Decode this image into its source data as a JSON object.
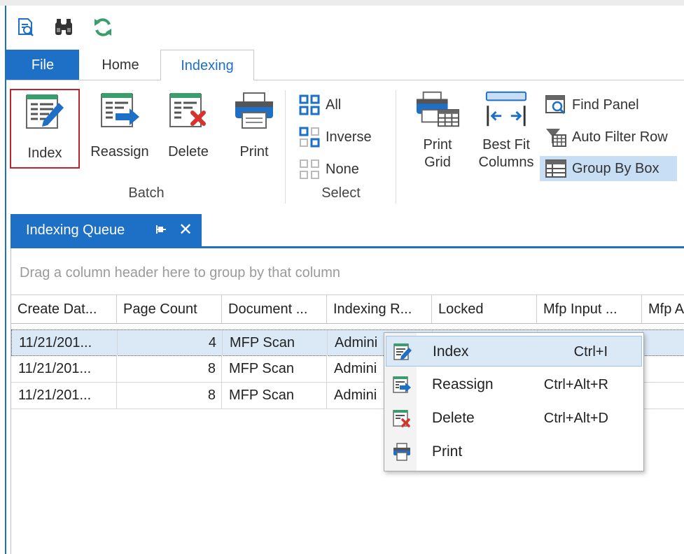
{
  "ribbon": {
    "tabs": [
      {
        "label": "File"
      },
      {
        "label": "Home"
      },
      {
        "label": "Indexing"
      }
    ],
    "active_tab": "Indexing",
    "batch": {
      "label": "Batch",
      "buttons": [
        {
          "label": "Index"
        },
        {
          "label": "Reassign"
        },
        {
          "label": "Delete"
        },
        {
          "label": "Print"
        }
      ]
    },
    "select": {
      "label": "Select",
      "buttons": [
        {
          "label": "All"
        },
        {
          "label": "Inverse"
        },
        {
          "label": "None"
        }
      ]
    },
    "grid_tools": {
      "print_grid": "Print\nGrid",
      "best_fit": "Best Fit\nColumns",
      "find_panel": "Find Panel",
      "auto_filter": "Auto Filter Row",
      "group_by_box": "Group By Box"
    }
  },
  "doc_tab": {
    "title": "Indexing Queue"
  },
  "grid": {
    "group_hint": "Drag a column header here to group by that column",
    "columns": [
      "Create Dat...",
      "Page Count",
      "Document ...",
      "Indexing R...",
      "Locked",
      "Mfp Input ...",
      "Mfp A"
    ],
    "rows": [
      {
        "create": "11/21/201...",
        "pages": "4",
        "doc": "MFP Scan",
        "indexing": "Admini",
        "locked": "",
        "mfp_input": "",
        "mfp_a": ""
      },
      {
        "create": "11/21/201...",
        "pages": "8",
        "doc": "MFP Scan",
        "indexing": "Admini",
        "locked": "",
        "mfp_input": "",
        "mfp_a": ""
      },
      {
        "create": "11/21/201...",
        "pages": "8",
        "doc": "MFP Scan",
        "indexing": "Admini",
        "locked": "",
        "mfp_input": "",
        "mfp_a": ""
      }
    ],
    "selected_row": 0
  },
  "context_menu": {
    "items": [
      {
        "label": "Index",
        "shortcut": "Ctrl+I",
        "icon": "index-icon"
      },
      {
        "label": "Reassign",
        "shortcut": "Ctrl+Alt+R",
        "icon": "reassign-icon"
      },
      {
        "label": "Delete",
        "shortcut": "Ctrl+Alt+D",
        "icon": "delete-icon"
      },
      {
        "label": "Print",
        "shortcut": "",
        "icon": "print-icon"
      }
    ]
  },
  "colors": {
    "accent": "#1e6fc6",
    "highlight": "#c7def4",
    "selection": "#dbe9f7",
    "focus_border": "#c0232f",
    "doc_green": "#3a9e6c",
    "delete_red": "#d9322c"
  }
}
